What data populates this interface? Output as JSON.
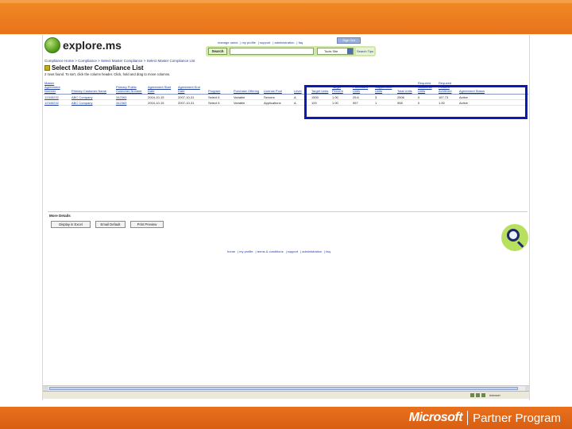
{
  "slide": {
    "footer_brand": "Microsoft",
    "footer_program": "Partner Program",
    "colors": {
      "top_band": "#e8731a",
      "bottom_band": "#d85f12",
      "highlight": "#0a1ab8"
    }
  },
  "site": {
    "logo_text": "explore.ms",
    "top_links": [
      "manage users",
      "my profile",
      "support",
      "administration",
      "faq"
    ],
    "signout_label": "Sign Out",
    "search_button": "Search",
    "search_value": "",
    "scope_value": "Tools Site",
    "search_go": "Search Tips"
  },
  "breadcrumb": "Compliance Home > Compliance > Select Master Compliance > Select Master Compliance List",
  "page_title": "Select Master Compliance List",
  "result_info": "2 rows found. To sort, click the column header. Click, hold and drag to move columns.",
  "table": {
    "headers": [
      "Master Agreement Number",
      "Primary Customer Name",
      "Primary Public Customer Number",
      "Agreement Start Date",
      "Agreement End Date",
      "Program",
      "Purchase Offering",
      "License Pool",
      "Level",
      "Target Units",
      "Target Percent",
      "Purchased Units",
      "Supplement Units",
      "Total Units",
      "Required Additional Units",
      "Required Percent Achieved",
      "Agreement Status"
    ],
    "rows": [
      [
        "12345232",
        "ABC Company",
        "342363",
        "2004-10-15",
        "2007-10-31",
        "Select 6",
        "Variable",
        "Servers",
        "A",
        "1500",
        "1.00",
        "25.6",
        "3",
        "2506",
        "0",
        "167.73",
        "Active"
      ],
      [
        "12345232",
        "ABC Company",
        "342363",
        "2004-10-15",
        "2007-10-31",
        "Select 6",
        "Variable",
        "Applications",
        "A",
        "100",
        "1.00",
        "957",
        "1",
        "958",
        "0",
        "1.00",
        "Active"
      ]
    ]
  },
  "more_details": {
    "label": "More Details",
    "buttons": [
      "Display in Excel",
      "Email Default",
      "Print Preview"
    ]
  },
  "footer_links": [
    "home",
    "my profile",
    "terms & conditions",
    "support",
    "administration",
    "faq"
  ],
  "status": {
    "zone": "Internet"
  }
}
